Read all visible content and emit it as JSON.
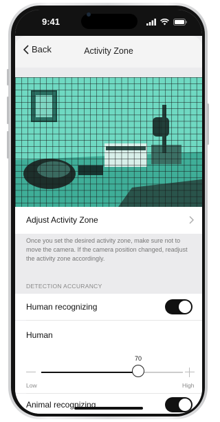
{
  "status_bar": {
    "time": "9:41"
  },
  "nav": {
    "back_label": "Back",
    "title": "Activity Zone"
  },
  "camera": {
    "grid_color": "#1a1a1a",
    "zone_tint": "#3fd6b7"
  },
  "adjust_row": {
    "label": "Adjust Activity Zone"
  },
  "note": "Once you set the desired activity zone, make sure not to move the camera. If the camera position changed, readjust the activity zone accordingly.",
  "section_header": "DETECTION ACCURANCY",
  "human_recognizing": {
    "label": "Human recognizing",
    "enabled": true
  },
  "human_slider": {
    "label": "Human",
    "value": 70,
    "min_label": "Low",
    "max_label": "High"
  },
  "animal_recognizing": {
    "label": "Animal recognizing",
    "enabled": true
  }
}
